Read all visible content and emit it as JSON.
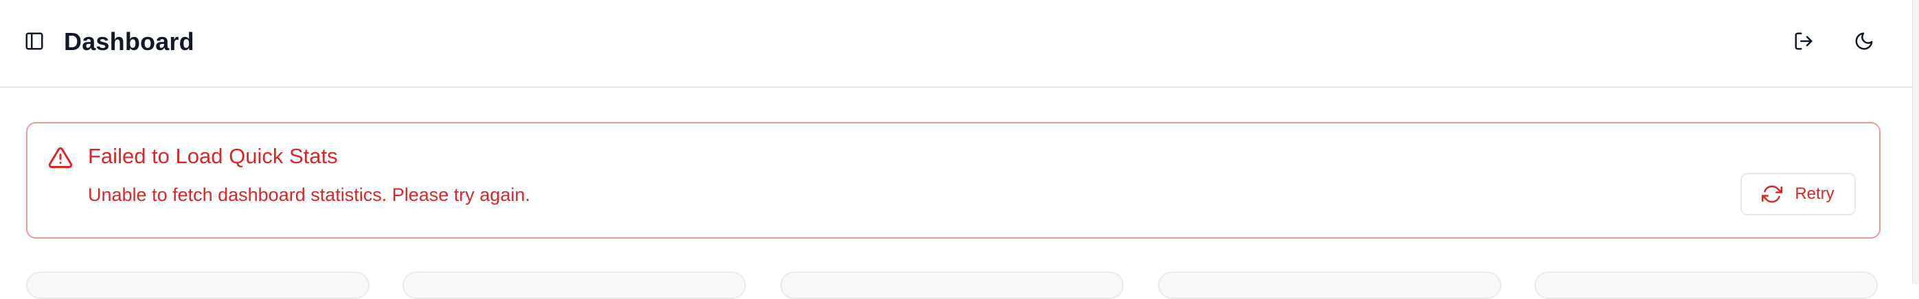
{
  "header": {
    "title": "Dashboard",
    "icons": {
      "sidebar_toggle": "sidebar-panel-icon",
      "logout": "log-out-icon",
      "theme": "moon-icon"
    }
  },
  "alert": {
    "title": "Failed to Load Quick Stats",
    "description": "Unable to fetch dashboard statistics. Please try again.",
    "retry_label": "Retry",
    "icon": "alert-triangle-icon",
    "retry_icon": "refresh-icon",
    "accent_color": "#dc2626",
    "border_color": "#ef9a9a"
  },
  "stats": {
    "card_count_visible": 5
  }
}
